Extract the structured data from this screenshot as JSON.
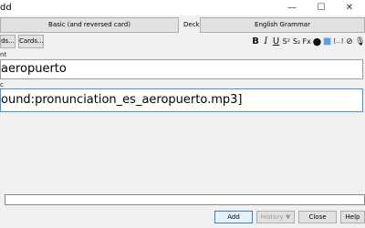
{
  "window": {
    "title": "dd",
    "minimize_glyph": "—",
    "maximize_glyph": "☐",
    "close_glyph": "✕"
  },
  "toolbar": {
    "notetype_label": "Basic (and reversed card)",
    "deck_label": "Deck",
    "deck_value": "English Grammar"
  },
  "fields_bar": {
    "fields_button": "ds...",
    "cards_button": "Cards...",
    "tools": [
      {
        "name": "bold-icon",
        "glyph": "B"
      },
      {
        "name": "italic-icon",
        "glyph": "I"
      },
      {
        "name": "underline-icon",
        "glyph": "U"
      },
      {
        "name": "superscript-icon",
        "glyph": "S²"
      },
      {
        "name": "subscript-icon",
        "glyph": "S₂"
      },
      {
        "name": "clear-format-icon",
        "glyph": "Fx"
      },
      {
        "name": "text-color-icon",
        "glyph": "●"
      },
      {
        "name": "highlight-color-icon",
        "glyph": "■"
      },
      {
        "name": "cloze-icon",
        "glyph": "[...]"
      },
      {
        "name": "attach-icon",
        "glyph": "⊘"
      },
      {
        "name": "record-audio-icon",
        "glyph": "🎙"
      }
    ]
  },
  "fields": {
    "front_label": "nt",
    "front_value": "aeropuerto",
    "back_label": "c",
    "back_value": "ound:pronunciation_es_aeropuerto.mp3]"
  },
  "tags": {
    "value": ""
  },
  "bottom_bar": {
    "add_label": "Add",
    "history_label": "History ▼",
    "close_label": "Close",
    "help_label": "Help"
  },
  "colors": {
    "focus_border": "#4a90d9",
    "text_color_swatch": "#111111",
    "highlight_swatch": "#5aa0e6"
  }
}
